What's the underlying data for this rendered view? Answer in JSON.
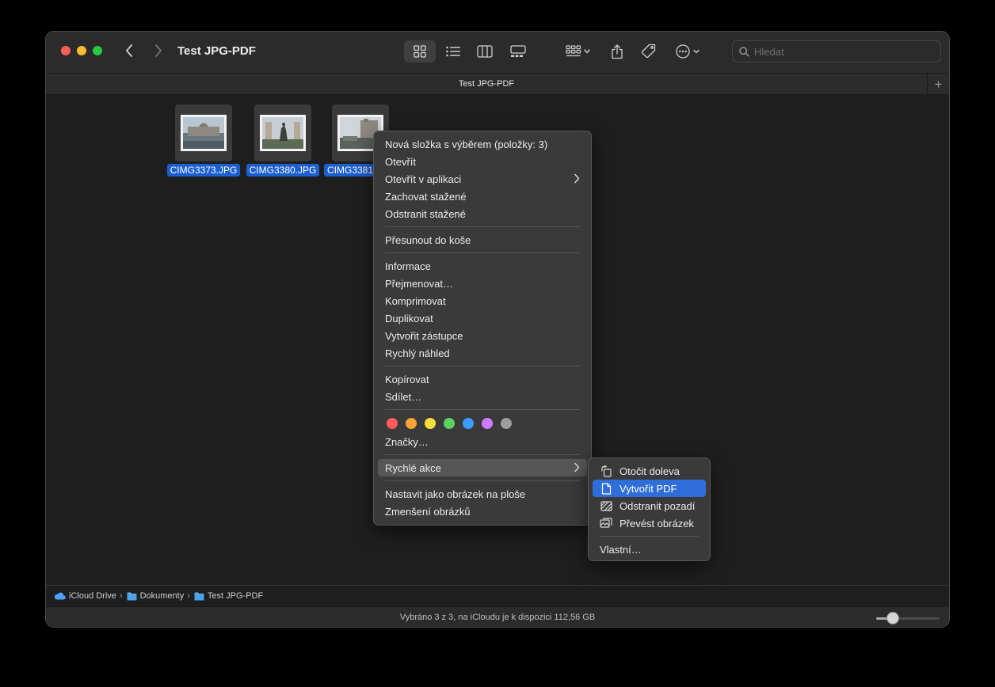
{
  "window": {
    "title": "Test JPG-PDF",
    "tab_title": "Test JPG-PDF",
    "tab_add": "+",
    "search_placeholder": "Hledat"
  },
  "toolbar": {
    "view_modes": [
      "icon-view",
      "list-view",
      "column-view",
      "gallery-view"
    ],
    "active_view": "icon-view",
    "buttons": [
      "group-icon",
      "share-icon",
      "tag-icon",
      "more-icon"
    ]
  },
  "files": [
    {
      "name": "CIMG3373.JPG"
    },
    {
      "name": "CIMG3380.JPG"
    },
    {
      "name": "CIMG3381"
    }
  ],
  "context_menu": {
    "group1": [
      "Nová složka s výběrem (položky: 3)",
      "Otevřít",
      "Otevřít v aplikaci",
      "Zachovat stažené",
      "Odstranit stažené"
    ],
    "group2": [
      "Přesunout do koše"
    ],
    "group3": [
      "Informace",
      "Přejmenovat…",
      "Komprimovat",
      "Duplikovat",
      "Vytvořit zástupce",
      "Rychlý náhled"
    ],
    "group4": [
      "Kopírovat",
      "Sdílet…"
    ],
    "tag_colors": [
      "#ff5b5b",
      "#ffa33a",
      "#fddb3a",
      "#5bd25b",
      "#3d9bff",
      "#cd7bff",
      "#9e9e9e"
    ],
    "tags_label": "Značky…",
    "quick_actions": "Rychlé akce",
    "group6": [
      "Nastavit jako obrázek na ploše",
      "Zmenšení obrázků"
    ]
  },
  "submenu": {
    "items": [
      {
        "label": "Otočit doleva",
        "icon": "rotate-left-icon"
      },
      {
        "label": "Vytvořit PDF",
        "icon": "pdf-document-icon"
      },
      {
        "label": "Odstranit pozadí",
        "icon": "remove-background-icon"
      },
      {
        "label": "Převést obrázek",
        "icon": "convert-image-icon"
      }
    ],
    "custom": "Vlastní…"
  },
  "pathbar": {
    "segments": [
      "iCloud Drive",
      "Dokumenty",
      "Test JPG-PDF"
    ]
  },
  "status": {
    "text": "Vybráno 3 z 3, na iCloudu je k dispozici 112,56 GB",
    "zoom_level": 0.25
  }
}
